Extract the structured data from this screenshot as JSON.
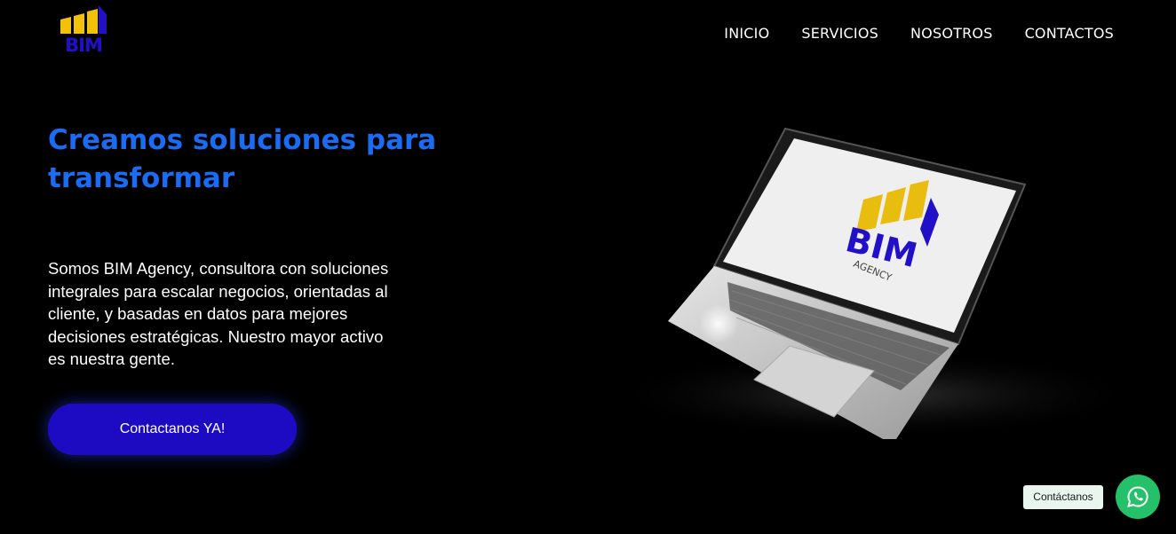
{
  "brand": {
    "logo_text": "BIM",
    "primary_color": "#1d0bc4",
    "accent_yellow": "#f2c20a",
    "title_color": "#1a6cf5"
  },
  "nav": {
    "items": [
      {
        "label": "INICIO"
      },
      {
        "label": "SERVICIOS"
      },
      {
        "label": "NOSOTROS"
      },
      {
        "label": "CONTACTOS"
      }
    ]
  },
  "hero": {
    "title": "Creamos soluciones para transformar",
    "description": "Somos BIM Agency, consultora con soluciones integrales para escalar negocios, orientadas al cliente, y basadas en datos para mejores decisiones estratégicas. Nuestro mayor activo es nuestra gente.",
    "cta_label": "Contactanos YA!"
  },
  "laptop_screen": {
    "logo_text": "BIM",
    "subtitle": "AGENCY"
  },
  "chat_widget": {
    "label": "Contáctanos",
    "icon": "whatsapp-icon",
    "color": "#25c06a"
  }
}
